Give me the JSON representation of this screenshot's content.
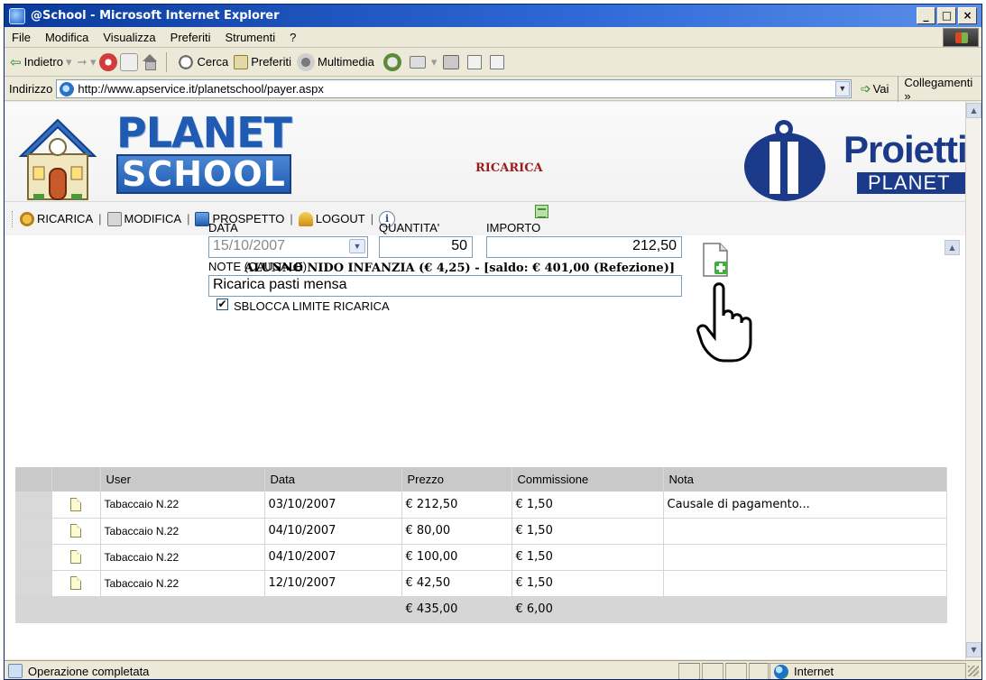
{
  "window": {
    "title": "@School - Microsoft Internet Explorer"
  },
  "menu": [
    "File",
    "Modifica",
    "Visualizza",
    "Preferiti",
    "Strumenti",
    "?"
  ],
  "toolbar": {
    "back": "Indietro",
    "search": "Cerca",
    "favorites": "Preferiti",
    "media": "Multimedia"
  },
  "address": {
    "label": "Indirizzo",
    "url": "http://www.apservice.it/planetschool/payer.aspx",
    "go": "Vai",
    "links": "Collegamenti"
  },
  "header": {
    "logo_top": "PLANET",
    "logo_bottom": "SCHOOL",
    "page_title": "RICARICA",
    "partner_name": "Proietti",
    "partner_sub": "PLANET"
  },
  "nav": [
    {
      "label": "RICARICA",
      "icon": "recharge-icon"
    },
    {
      "label": "MODIFICA",
      "icon": "edit-icon"
    },
    {
      "label": "PROSPETTO",
      "icon": "report-icon"
    },
    {
      "label": "LOGOUT",
      "icon": "logout-icon"
    },
    {
      "label": "",
      "icon": "info-icon"
    }
  ],
  "form": {
    "student": "ALUNNO NIDO INFANZIA (€ 4,25) - [saldo: € 401,00 (Refezione)]",
    "date_label": "DATA",
    "date_value": "15/10/2007",
    "quantity_label": "QUANTITA'",
    "quantity_value": "50",
    "amount_label": "IMPORTO",
    "amount_value": "212,50",
    "note_label": "NOTE (CAUSALE)",
    "note_value": "Ricarica pasti mensa",
    "unlock_label": "SBLOCCA LIMITE RICARICA",
    "unlock_checked": "✔"
  },
  "table": {
    "headers": [
      "User",
      "Data",
      "Prezzo",
      "Commissione",
      "Nota"
    ],
    "rows": [
      {
        "user": "Tabaccaio N.22",
        "date": "03/10/2007",
        "price": "€ 212,50",
        "fee": "€ 1,50",
        "note": "Causale di pagamento..."
      },
      {
        "user": "Tabaccaio N.22",
        "date": "04/10/2007",
        "price": "€ 80,00",
        "fee": "€ 1,50",
        "note": ""
      },
      {
        "user": "Tabaccaio N.22",
        "date": "04/10/2007",
        "price": "€ 100,00",
        "fee": "€ 1,50",
        "note": ""
      },
      {
        "user": "Tabaccaio N.22",
        "date": "12/10/2007",
        "price": "€ 42,50",
        "fee": "€ 1,50",
        "note": ""
      }
    ],
    "totals": {
      "price": "€ 435,00",
      "fee": "€ 6,00"
    }
  },
  "status": {
    "text": "Operazione completata",
    "zone": "Internet"
  },
  "colors": {
    "title_bar": "#0a3a9c",
    "brand_blue": "#1f5bb2",
    "page_title_red": "#9b1b1b",
    "grid_header": "#c9c9c9"
  }
}
